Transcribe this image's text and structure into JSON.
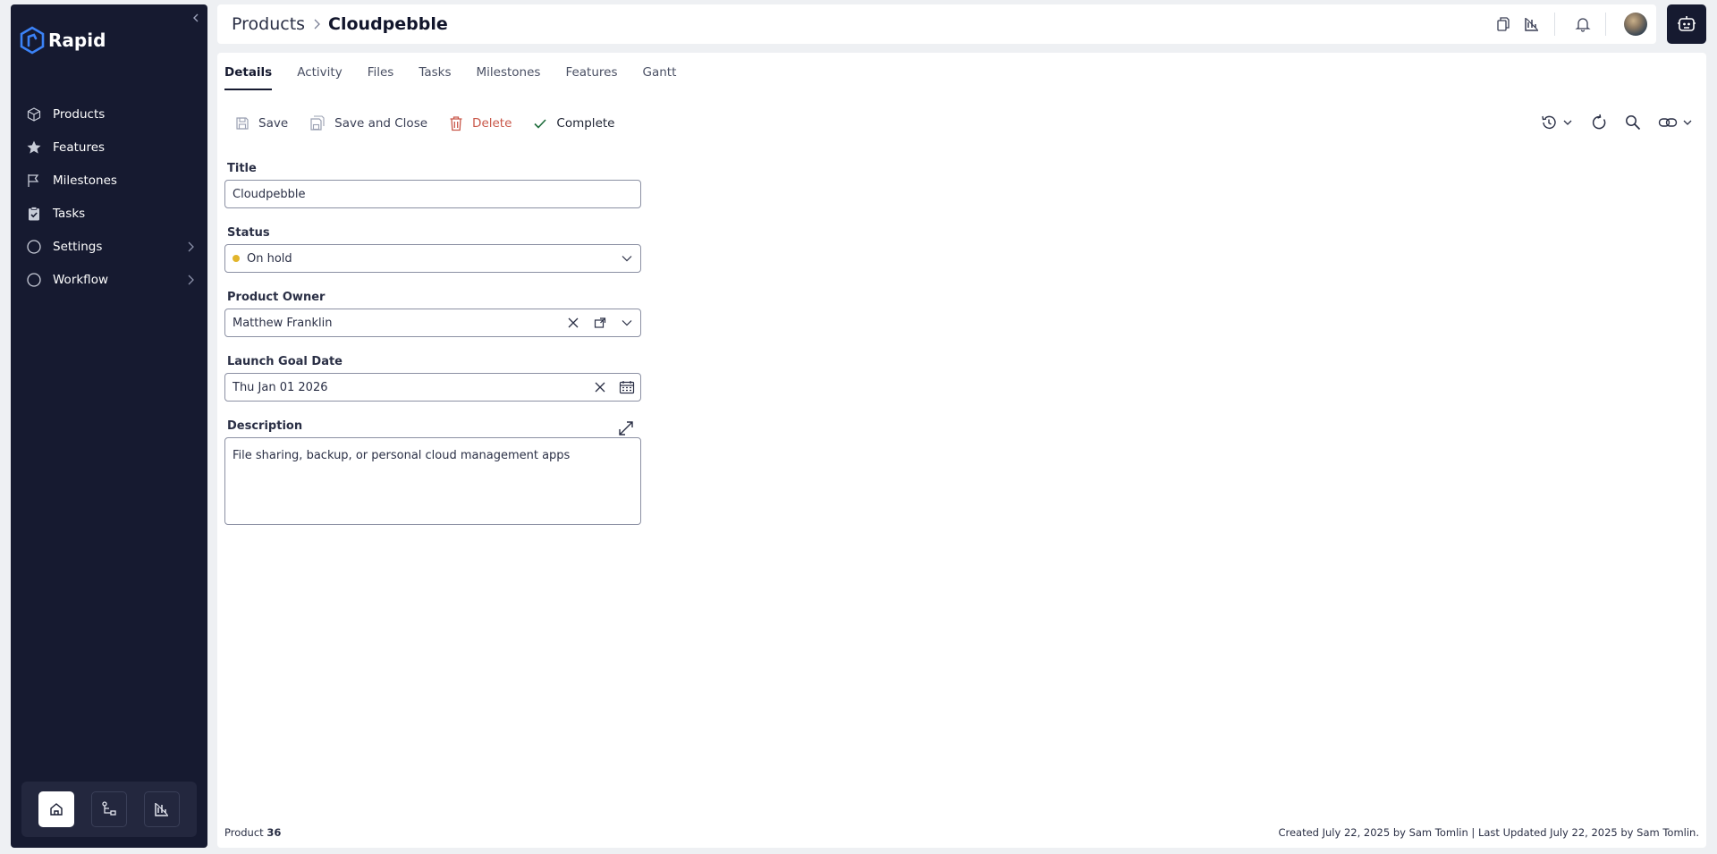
{
  "app": {
    "name": "Rapid"
  },
  "sidebar": {
    "items": [
      {
        "label": "Products",
        "icon": "cube-icon"
      },
      {
        "label": "Features",
        "icon": "star-icon"
      },
      {
        "label": "Milestones",
        "icon": "flag-icon"
      },
      {
        "label": "Tasks",
        "icon": "clipboard-check-icon"
      },
      {
        "label": "Settings",
        "icon": "circle-icon",
        "has_children": true
      },
      {
        "label": "Workflow",
        "icon": "circle-icon",
        "has_children": true
      }
    ],
    "dock": [
      {
        "icon": "home-icon",
        "active": true
      },
      {
        "icon": "flowchart-icon",
        "active": false
      },
      {
        "icon": "chart-icon",
        "active": false
      }
    ]
  },
  "header": {
    "breadcrumb_root": "Products",
    "breadcrumb_current": "Cloudpebble"
  },
  "tabs": [
    {
      "label": "Details",
      "active": true
    },
    {
      "label": "Activity",
      "active": false
    },
    {
      "label": "Files",
      "active": false
    },
    {
      "label": "Tasks",
      "active": false
    },
    {
      "label": "Milestones",
      "active": false
    },
    {
      "label": "Features",
      "active": false
    },
    {
      "label": "Gantt",
      "active": false
    }
  ],
  "toolbar": {
    "save": "Save",
    "save_close": "Save and Close",
    "delete": "Delete",
    "complete": "Complete"
  },
  "form": {
    "title_label": "Title",
    "title_value": "Cloudpebble",
    "status_label": "Status",
    "status_value": "On hold",
    "status_color": "#e2b52b",
    "owner_label": "Product Owner",
    "owner_value": "Matthew Franklin",
    "launch_label": "Launch Goal Date",
    "launch_value": "Thu Jan 01 2026",
    "description_label": "Description",
    "description_value": "File sharing, backup, or personal cloud management apps"
  },
  "footer": {
    "record_type": "Product",
    "record_id": "36",
    "audit": "Created July 22, 2025 by Sam Tomlin | Last Updated July 22, 2025 by Sam Tomlin."
  },
  "colors": {
    "sidebar_bg": "#161a30",
    "delete": "#c9584a",
    "complete_check": "#1c6b3a",
    "status_on_hold": "#e2b52b"
  }
}
